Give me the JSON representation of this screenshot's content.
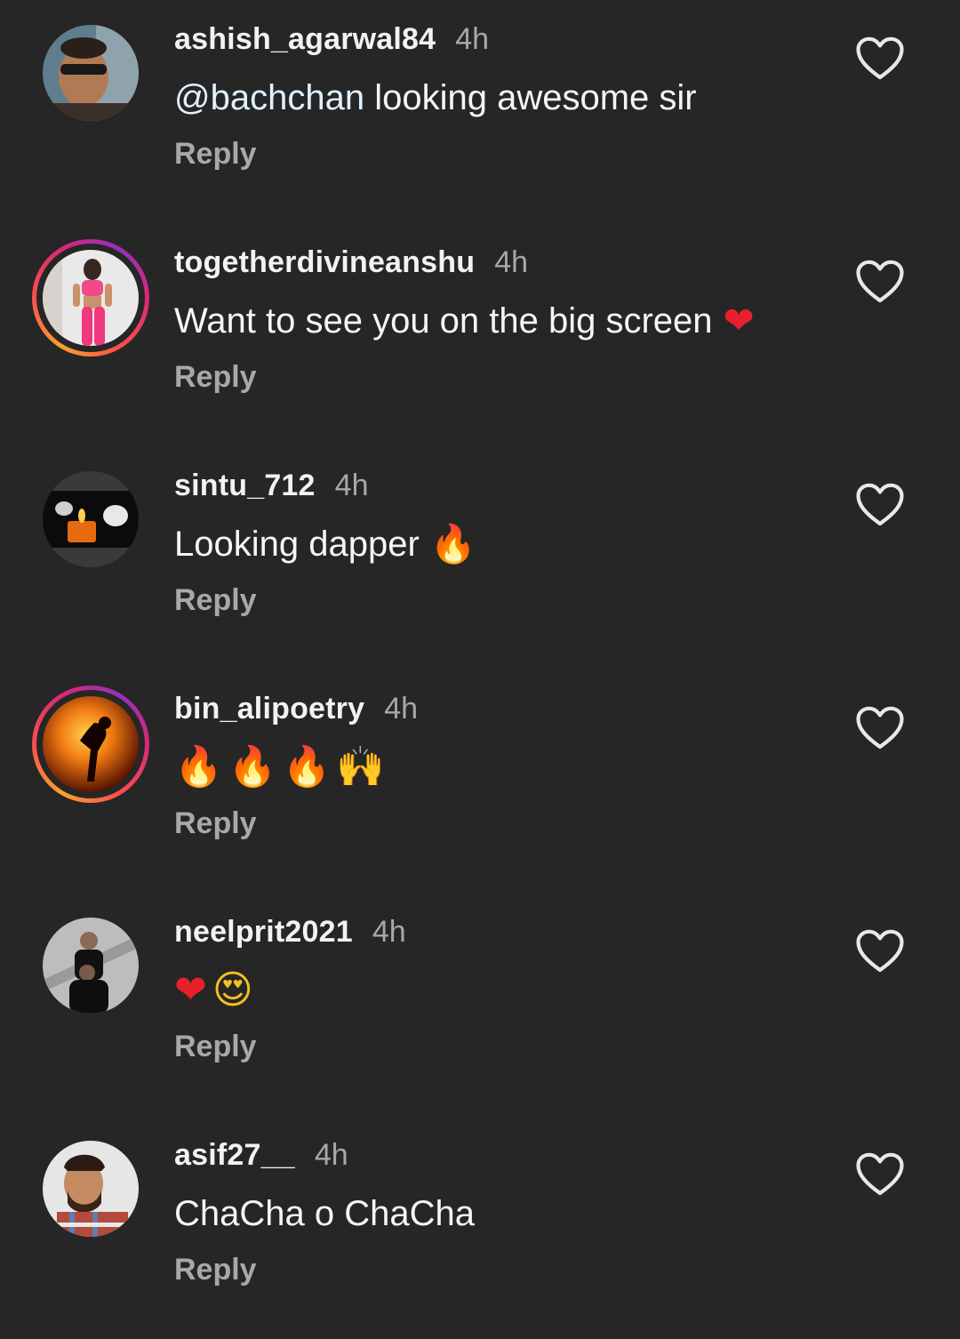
{
  "colors": {
    "background": "#262626",
    "text_primary": "#f5f5f5",
    "text_secondary": "#a8a8a8",
    "mention": "#e0f1ff",
    "story_ring_start": "#f9a12e",
    "story_ring_end": "#962fbf"
  },
  "comments": [
    {
      "username": "ashish_agarwal84",
      "time": "4h",
      "mention": "@bachchan",
      "text": " looking awesome sir",
      "reply_label": "Reply",
      "like_icon": "heart-outline-icon",
      "has_story_ring": false
    },
    {
      "username": "togetherdivineanshu",
      "time": "4h",
      "text": "Want to see you on the big screen",
      "emojis": [
        "❤"
      ],
      "reply_label": "Reply",
      "like_icon": "heart-outline-icon",
      "has_story_ring": true
    },
    {
      "username": "sintu_712",
      "time": "4h",
      "text": "Looking dapper",
      "emojis": [
        "🔥"
      ],
      "reply_label": "Reply",
      "like_icon": "heart-outline-icon",
      "has_story_ring": false
    },
    {
      "username": "bin_alipoetry",
      "time": "4h",
      "text": "",
      "emojis": [
        "🔥",
        "🔥",
        "🔥",
        "🙌"
      ],
      "reply_label": "Reply",
      "like_icon": "heart-outline-icon",
      "has_story_ring": true
    },
    {
      "username": "neelprit2021",
      "time": "4h",
      "text": "",
      "emojis": [
        "❤",
        "😍"
      ],
      "reply_label": "Reply",
      "like_icon": "heart-outline-icon",
      "has_story_ring": false
    },
    {
      "username": "asif27__",
      "time": "4h",
      "text": "ChaCha o ChaCha",
      "reply_label": "Reply",
      "like_icon": "heart-outline-icon",
      "has_story_ring": false
    }
  ]
}
